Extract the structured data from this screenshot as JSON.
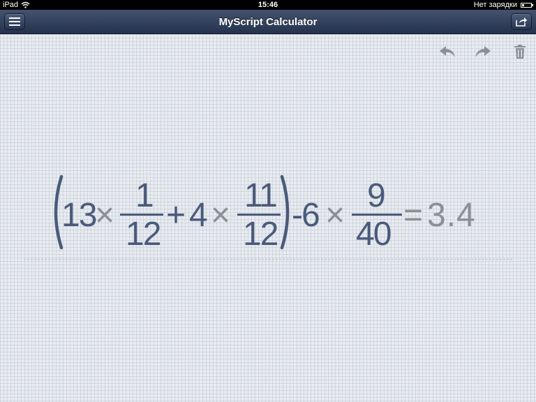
{
  "status_bar": {
    "device": "iPad",
    "time": "15:46",
    "battery_text": "Нет зарядки",
    "wifi_icon": "wifi-icon",
    "battery_icon": "battery-icon"
  },
  "nav": {
    "title": "MyScript Calculator",
    "menu_icon": "menu-icon",
    "share_icon": "share-icon"
  },
  "toolbar": {
    "undo_icon": "undo-icon",
    "redo_icon": "redo-icon",
    "trash_icon": "trash-icon"
  },
  "expression": {
    "term1_whole": "13",
    "times": "×",
    "frac1_num": "1",
    "frac1_den": "12",
    "plus": "+",
    "term2_whole": "4",
    "frac2_num": "11",
    "frac2_den": "12",
    "minus_term": "-6",
    "frac3_num": "9",
    "frac3_den": "40",
    "equals": "=",
    "result": "3.4"
  },
  "colors": {
    "ink": "#4a5a7b",
    "result": "#8c8e93",
    "navbar": "#2f3d5a"
  }
}
